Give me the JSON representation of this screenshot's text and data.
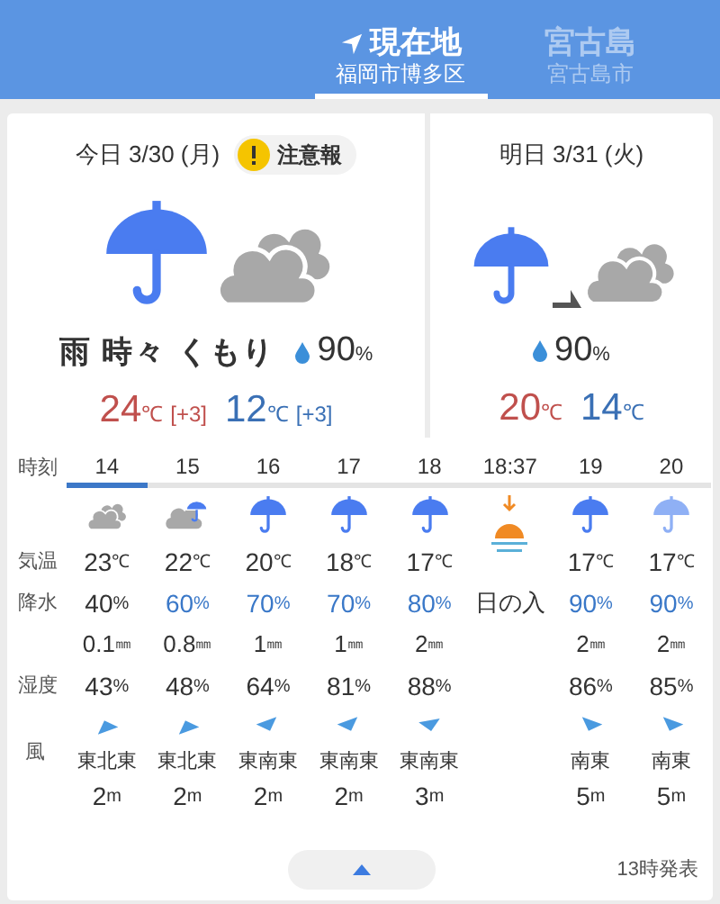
{
  "tabs": [
    {
      "title": "現在地",
      "subtitle": "福岡市博多区",
      "selected": true,
      "kind": "current"
    },
    {
      "title": "宮古島",
      "subtitle": "宮古島市",
      "selected": false,
      "kind": "place"
    }
  ],
  "days": [
    {
      "date": "今日 3/30 (月)",
      "alert": "注意報",
      "kind": "rain-sometimes-cloudy",
      "weather": "雨 時々 くもり",
      "precip": "90",
      "precip_unit": "%",
      "high": "24",
      "high_unit": "℃",
      "high_diff": "[+3]",
      "low": "12",
      "low_unit": "℃",
      "low_diff": "[+3]"
    },
    {
      "date": "明日 3/31 (火)",
      "kind": "rain-then-cloudy",
      "precip": "90",
      "precip_unit": "%",
      "high": "20",
      "high_unit": "℃",
      "low": "14",
      "low_unit": "℃"
    }
  ],
  "hourly": {
    "labels": {
      "time": "時刻",
      "temp": "気温",
      "precip": "降水",
      "humidity": "湿度",
      "wind": "風"
    },
    "hours": [
      {
        "kind": "cloudy",
        "time": "14",
        "selected": true,
        "temp": "23",
        "temp_unit": "℃",
        "precip": "40",
        "precip_unit": "%",
        "high": false,
        "amount": "0.1",
        "amount_unit": "㎜",
        "humidity": "43",
        "humidity_unit": "%",
        "wind_dir": "東北東",
        "wind_speed": "2",
        "wind_unit": "m"
      },
      {
        "kind": "cloud-rain",
        "time": "15",
        "selected": false,
        "temp": "22",
        "temp_unit": "℃",
        "precip": "60",
        "precip_unit": "%",
        "high": true,
        "amount": "0.8",
        "amount_unit": "㎜",
        "humidity": "48",
        "humidity_unit": "%",
        "wind_dir": "東北東",
        "wind_speed": "2",
        "wind_unit": "m"
      },
      {
        "kind": "rain",
        "time": "16",
        "selected": false,
        "temp": "20",
        "temp_unit": "℃",
        "precip": "70",
        "precip_unit": "%",
        "high": true,
        "amount": "1",
        "amount_unit": "㎜",
        "humidity": "64",
        "humidity_unit": "%",
        "wind_dir": "東南東",
        "wind_speed": "2",
        "wind_unit": "m"
      },
      {
        "kind": "rain",
        "time": "17",
        "selected": false,
        "temp": "18",
        "temp_unit": "℃",
        "precip": "70",
        "precip_unit": "%",
        "high": true,
        "amount": "1",
        "amount_unit": "㎜",
        "humidity": "81",
        "humidity_unit": "%",
        "wind_dir": "東南東",
        "wind_speed": "2",
        "wind_unit": "m"
      },
      {
        "kind": "rain",
        "time": "18",
        "selected": false,
        "temp": "17",
        "temp_unit": "℃",
        "precip": "80",
        "precip_unit": "%",
        "high": true,
        "amount": "2",
        "amount_unit": "㎜",
        "humidity": "88",
        "humidity_unit": "%",
        "wind_dir": "東南東",
        "wind_speed": "3",
        "wind_unit": "m"
      },
      {
        "kind": "sunset",
        "time": "18:37",
        "selected": false,
        "label": "日の入"
      },
      {
        "kind": "rain",
        "time": "19",
        "selected": false,
        "temp": "17",
        "temp_unit": "℃",
        "precip": "90",
        "precip_unit": "%",
        "high": true,
        "amount": "2",
        "amount_unit": "㎜",
        "humidity": "86",
        "humidity_unit": "%",
        "wind_dir": "南東",
        "wind_speed": "5",
        "wind_unit": "m"
      },
      {
        "kind": "rain",
        "time": "20",
        "selected": false,
        "temp": "17",
        "temp_unit": "℃",
        "precip": "90",
        "precip_unit": "%",
        "high": true,
        "amount": "2",
        "amount_unit": "㎜",
        "humidity": "85",
        "humidity_unit": "%",
        "wind_dir": "南東",
        "wind_speed": "5",
        "wind_unit": "m"
      }
    ]
  },
  "footer": {
    "issued": "13時発表"
  }
}
